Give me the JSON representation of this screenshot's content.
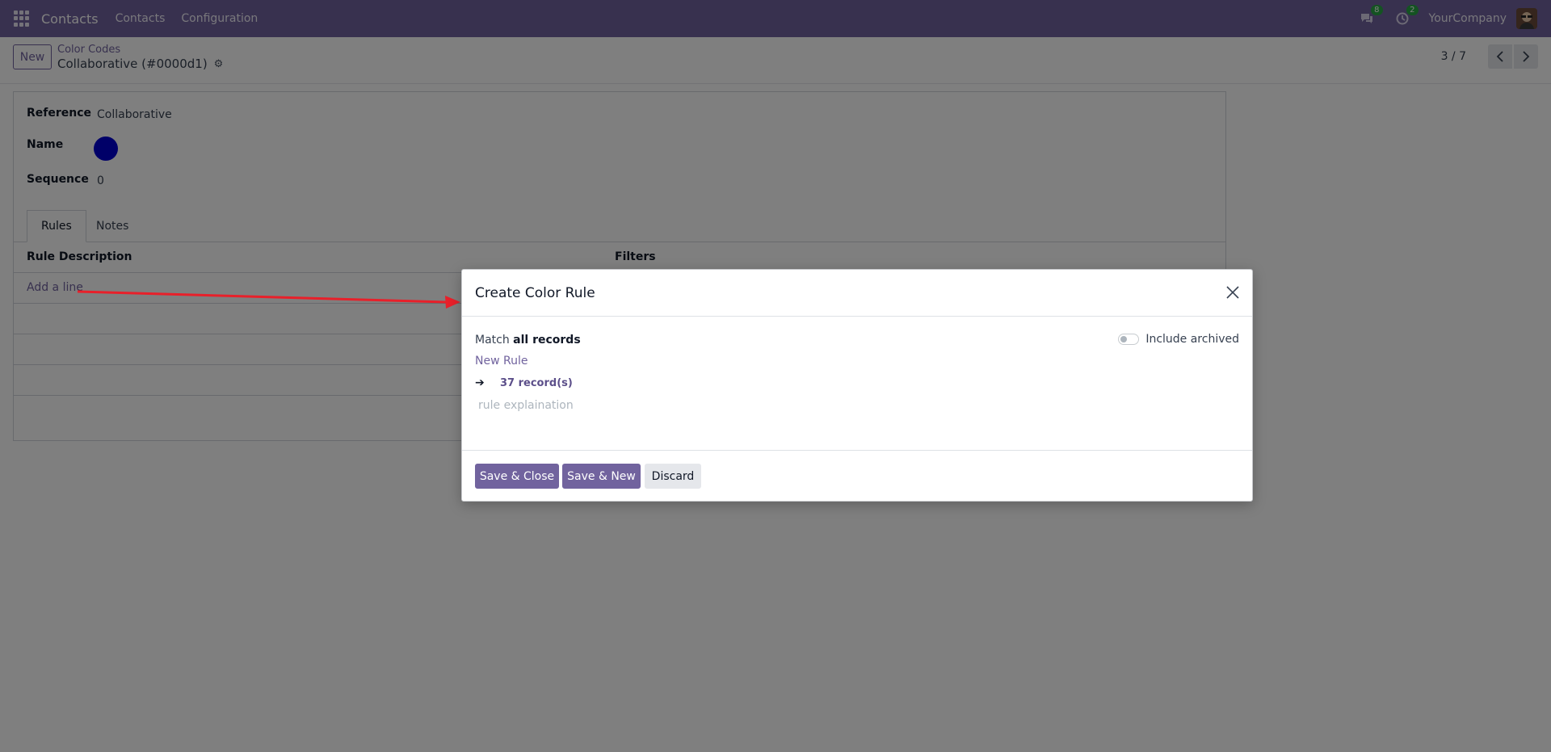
{
  "navbar": {
    "app_name": "Contacts",
    "menu": [
      "Contacts",
      "Configuration"
    ],
    "messages_count": "8",
    "activities_count": "2",
    "company": "YourCompany"
  },
  "control_panel": {
    "new_label": "New",
    "breadcrumb_parent": "Color Codes",
    "breadcrumb_current": "Collaborative (#0000d1)",
    "pager": "3 / 7"
  },
  "form": {
    "reference_label": "Reference",
    "reference_value": "Collaborative",
    "name_label": "Name",
    "name_color": "#0000d1",
    "sequence_label": "Sequence",
    "sequence_value": "0",
    "tabs": [
      "Rules",
      "Notes"
    ],
    "columns": [
      "Rule Description",
      "Filters"
    ],
    "add_line": "Add a line"
  },
  "dialog": {
    "title": "Create Color Rule",
    "match_prefix": "Match",
    "match_scope": "all records",
    "include_archived": "Include archived",
    "new_rule": "New Rule",
    "record_count": "37 record(s)",
    "explanation_placeholder": "rule explaination",
    "buttons": {
      "save_close": "Save & Close",
      "save_new": "Save & New",
      "discard": "Discard"
    }
  },
  "colors": {
    "brand": "#71639e",
    "annotation_arrow": "#e8202a"
  }
}
